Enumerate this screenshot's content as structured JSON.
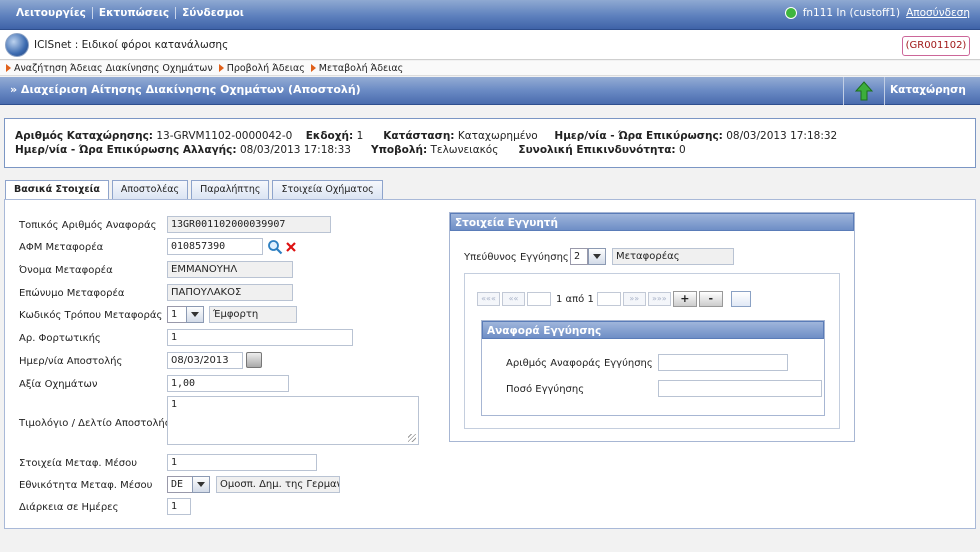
{
  "top_menu": [
    "Λειτουργίες",
    "Εκτυπώσεις",
    "Σύνδεσμοι"
  ],
  "user": {
    "name": "fn111 In (custoff1)",
    "logout": "Αποσύνδεση"
  },
  "app": {
    "title": "ICISnet : Ειδικοί φόροι κατανάλωσης",
    "code": "(GR001102)"
  },
  "breadcrumbs": [
    "Αναζήτηση Άδειας Διακίνησης Οχημάτων",
    "Προβολή Άδειας",
    "Μεταβολή Άδειας"
  ],
  "page_title": "» Διαχείριση Αίτησης Διακίνησης Οχημάτων (Αποστολή)",
  "save_label": "Καταχώρηση",
  "info": {
    "reg_no_label": "Αριθμός Καταχώρησης:",
    "reg_no": "13-GRVM1102-0000042-0",
    "version_label": "Εκδοχή:",
    "version": "1",
    "status_label": "Κατάσταση:",
    "status": "Καταχωρημένο",
    "confirm_label": "Ημερ/νία - Ώρα Επικύρωσης:",
    "confirm": "08/03/2013 17:18:32",
    "change_label": "Ημερ/νία - Ώρα Επικύρωσης Αλλαγής:",
    "change": "08/03/2013 17:18:33",
    "submit_label": "Υποβολή:",
    "submit": "Τελωνειακός",
    "risk_label": "Συνολική Επικινδυνότητα:",
    "risk": "0"
  },
  "tabs": [
    "Βασικά Στοιχεία",
    "Αποστολέας",
    "Παραλήπτης",
    "Στοιχεία Οχήματος"
  ],
  "form": {
    "local_ref_label": "Τοπικός Αριθμός Αναφοράς",
    "local_ref": "13GR001102000039907",
    "afm_label": "ΑΦΜ Μεταφορέα",
    "afm": "010857390",
    "name_label": "Όνομα Μεταφορέα",
    "name": "ΕΜΜΑΝΟΥΗΛ",
    "surname_label": "Επώνυμο Μεταφορέα",
    "surname": "ΠΑΠΟΥΛΑΚΟΣ",
    "mode_label": "Κωδικός Τρόπου Μεταφοράς",
    "mode_code": "1",
    "mode_desc": "Έμφορτη",
    "bill_label": "Αρ. Φορτωτικής",
    "bill": "1",
    "date_label": "Ημερ/νία Αποστολής",
    "date": "08/03/2013",
    "value_label": "Αξία Οχημάτων",
    "value": "1,00",
    "invoice_label": "Τιμολόγιο / Δελτίο Αποστολής",
    "invoice": "1",
    "transport_label": "Στοιχεία Μεταφ. Μέσου",
    "transport": "1",
    "nationality_label": "Εθνικότητα Μεταφ. Μέσου",
    "nationality_code": "DE",
    "nationality_desc": "Ομοσπ. Δημ. της Γερμαν",
    "duration_label": "Διάρκεια σε Ημέρες",
    "duration": "1"
  },
  "guarantor": {
    "header": "Στοιχεία Εγγυητή",
    "responsible_label": "Υπεύθυνος Εγγύησης",
    "responsible_code": "2",
    "responsible_desc": "Μεταφορέας",
    "pager": {
      "first": "«««",
      "prev": "««",
      "text": "1 από 1",
      "next": "»»",
      "last": "»»»",
      "add": "+",
      "remove": "-"
    },
    "ref_header": "Αναφορά Εγγύησης",
    "ref_no_label": "Αριθμός Αναφοράς Εγγύησης",
    "ref_no": "",
    "amount_label": "Ποσό Εγγύησης",
    "amount": ""
  },
  "colors": {
    "accent": "#5d80bd",
    "code_text": "#a01818"
  }
}
